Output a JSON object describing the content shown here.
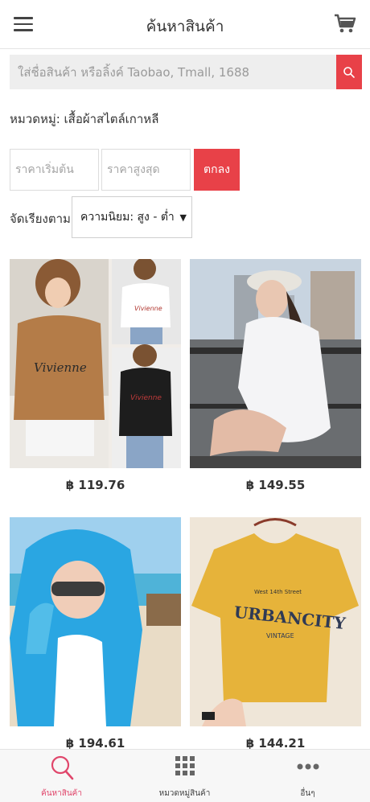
{
  "header": {
    "title": "ค้นหาสินค้า",
    "menu_icon": "hamburger-menu-icon",
    "cart_icon": "shopping-cart-icon"
  },
  "search": {
    "placeholder": "ใส่ชื่อสินค้า หรือลิ้งค์ Taobao, Tmall, 1688",
    "value": "",
    "button_icon": "search-icon",
    "accent": "#e84148"
  },
  "category": {
    "text": "หมวดหมู่: เสื้อผ้าสไตล์เกาหลี"
  },
  "price_filter": {
    "min_placeholder": "ราคาเริ่มต้น",
    "max_placeholder": "ราคาสูงสุด",
    "ok_label": "ตกลง"
  },
  "sort": {
    "label": "จัดเรียงตาม",
    "selected": "ความนิยม: สูง - ต่ำ"
  },
  "products": [
    {
      "price": "฿ 119.76",
      "image": "brown-vivienne-tshirt-collage"
    },
    {
      "price": "฿ 149.55",
      "image": "girl-white-oversized-shirt-cap"
    },
    {
      "price": "฿ 194.61",
      "image": "girl-blue-sun-protection-jacket"
    },
    {
      "price": "฿ 144.21",
      "image": "yellow-urbancity-tshirt"
    }
  ],
  "bottom_nav": [
    {
      "label": "ค้นหาสินค้า",
      "icon": "search-icon",
      "active": true
    },
    {
      "label": "หมวดหมู่สินค้า",
      "icon": "grid-icon",
      "active": false
    },
    {
      "label": "อื่นๆ",
      "icon": "more-dots-icon",
      "active": false
    }
  ],
  "colors": {
    "accent_red": "#e84148",
    "active_nav": "#e0466b"
  }
}
